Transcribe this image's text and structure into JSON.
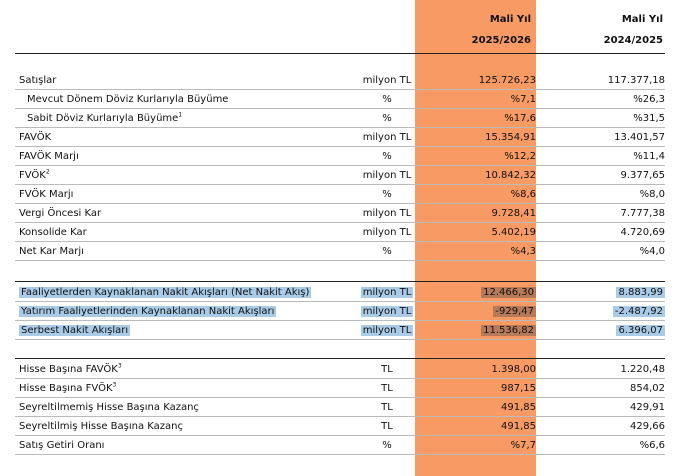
{
  "header": {
    "col1_title": "Mali Yıl",
    "col1_period": "2025/2026",
    "col2_title": "Mali Yıl",
    "col2_period": "2024/2025"
  },
  "rows": [
    {
      "label": "Satışlar",
      "sup": "",
      "unit": "milyon TL",
      "v1": "125.726,23",
      "v2": "117.377,18"
    },
    {
      "label": "Mevcut Dönem Döviz Kurlarıyla Büyüme",
      "sup": "",
      "unit": "%",
      "v1": "%7,1",
      "v2": "%26,3"
    },
    {
      "label": "Sabit Döviz Kurlarıyla Büyüme",
      "sup": "1",
      "unit": "%",
      "v1": "%17,6",
      "v2": "%31,5"
    },
    {
      "label": "FAVÖK",
      "sup": "",
      "unit": "milyon TL",
      "v1": "15.354,91",
      "v2": "13.401,57"
    },
    {
      "label": "FAVÖK Marjı",
      "sup": "",
      "unit": "%",
      "v1": "%12,2",
      "v2": "%11,4"
    },
    {
      "label": "FVÖK",
      "sup": "2",
      "unit": "milyon TL",
      "v1": "10.842,32",
      "v2": "9.377,65"
    },
    {
      "label": "FVÖK Marjı",
      "sup": "",
      "unit": "%",
      "v1": "%8,6",
      "v2": "%8,0"
    },
    {
      "label": "Vergi Öncesi Kar",
      "sup": "",
      "unit": "milyon TL",
      "v1": "9.728,41",
      "v2": "7.777,38"
    },
    {
      "label": "Konsolide Kar",
      "sup": "",
      "unit": "milyon TL",
      "v1": "5.402,19",
      "v2": "4.720,69"
    },
    {
      "label": "Net Kar Marjı",
      "sup": "",
      "unit": "%",
      "v1": "%4,3",
      "v2": "%4,0"
    },
    {
      "label": "Faaliyetlerden Kaynaklanan Nakit Akışları (Net Nakit Akış)",
      "sup": "",
      "unit": "milyon TL",
      "v1": "12.466,30",
      "v2": "8.883,99"
    },
    {
      "label": "Yatırım Faaliyetlerinden Kaynaklanan Nakit Akışları",
      "sup": "",
      "unit": "milyon TL",
      "v1": "-929,47",
      "v2": "-2.487,92"
    },
    {
      "label": "Serbest Nakit Akışları",
      "sup": "",
      "unit": "milyon TL",
      "v1": "11.536,82",
      "v2": "6.396,07"
    },
    {
      "label": "Hisse Başına FAVÖK",
      "sup": "3",
      "unit": "TL",
      "v1": "1.398,00",
      "v2": "1.220,48"
    },
    {
      "label": "Hisse Başına FVÖK",
      "sup": "3",
      "unit": "TL",
      "v1": "987,15",
      "v2": "854,02"
    },
    {
      "label": "Seyreltilmemiş Hisse Başına Kazanç",
      "sup": "",
      "unit": "TL",
      "v1": "491,85",
      "v2": "429,91"
    },
    {
      "label": "Seyreltilmiş Hisse Başına Kazanç",
      "sup": "",
      "unit": "TL",
      "v1": "491,85",
      "v2": "429,66"
    },
    {
      "label": "Satış Getiri Oranı",
      "sup": "",
      "unit": "%",
      "v1": "%7,7",
      "v2": "%6,6"
    }
  ]
}
